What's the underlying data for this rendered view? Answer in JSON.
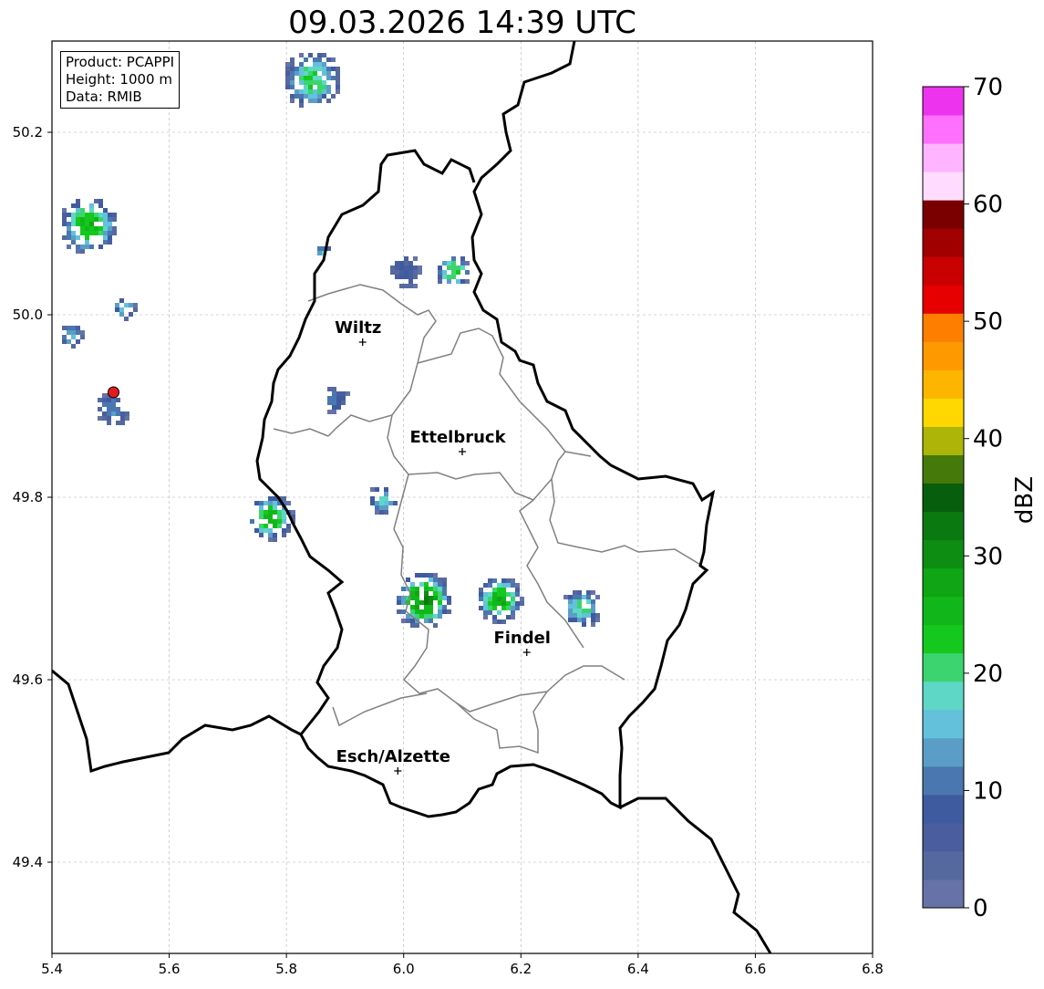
{
  "title": "09.03.2026 14:39 UTC",
  "info_box": {
    "product": "Product: PCAPPI",
    "height": "Height: 1000 m",
    "data": "Data: RMIB"
  },
  "axes": {
    "lon_range": [
      5.4,
      6.8
    ],
    "lat_range": [
      49.3,
      50.3
    ],
    "x_ticks": [
      "5.4",
      "5.6",
      "5.8",
      "6.0",
      "6.2",
      "6.4",
      "6.6",
      "6.8"
    ],
    "y_ticks": [
      "49.4",
      "49.6",
      "49.8",
      "50.0",
      "50.2"
    ],
    "grid": true
  },
  "cities": [
    {
      "name": "Wiltz",
      "lon": 5.93,
      "lat": 49.97
    },
    {
      "name": "Ettelbruck",
      "lon": 6.1,
      "lat": 49.85
    },
    {
      "name": "Findel",
      "lon": 6.21,
      "lat": 49.63
    },
    {
      "name": "Esch/Alzette",
      "lon": 5.99,
      "lat": 49.5
    }
  ],
  "radar_site": {
    "lon": 5.505,
    "lat": 49.915,
    "color": "#e41a1c"
  },
  "colorbar": {
    "label": "dBZ",
    "min": 0,
    "max": 70,
    "ticks": [
      "0",
      "10",
      "20",
      "30",
      "40",
      "50",
      "60",
      "70"
    ],
    "colors": [
      "#6673a8",
      "#56699f",
      "#4a5e9f",
      "#3f5ba0",
      "#4a77b0",
      "#5a9ec8",
      "#64c1dc",
      "#5fd7c6",
      "#3cd46e",
      "#14c81e",
      "#11b71a",
      "#10a515",
      "#0d8e12",
      "#0a7a10",
      "#075e0c",
      "#457a0a",
      "#adb508",
      "#fed800",
      "#feb500",
      "#fe9a00",
      "#fe7f00",
      "#e60000",
      "#c80000",
      "#a00000",
      "#7a0000",
      "#ffdcff",
      "#ffb4ff",
      "#ff70ff",
      "#ee33ee"
    ]
  },
  "echoes": [
    {
      "lon": 5.84,
      "lat": 50.26,
      "r": 0.05,
      "peak": 22
    },
    {
      "lon": 5.46,
      "lat": 50.1,
      "r": 0.05,
      "peak": 26
    },
    {
      "lon": 5.52,
      "lat": 50.01,
      "r": 0.02,
      "peak": 18
    },
    {
      "lon": 5.43,
      "lat": 49.98,
      "r": 0.02,
      "peak": 17
    },
    {
      "lon": 5.5,
      "lat": 49.9,
      "r": 0.03,
      "peak": 12
    },
    {
      "lon": 5.77,
      "lat": 49.78,
      "r": 0.04,
      "peak": 26
    },
    {
      "lon": 5.96,
      "lat": 49.8,
      "r": 0.025,
      "peak": 18
    },
    {
      "lon": 6.08,
      "lat": 50.05,
      "r": 0.03,
      "peak": 24
    },
    {
      "lon": 6.0,
      "lat": 50.05,
      "r": 0.03,
      "peak": 8
    },
    {
      "lon": 6.03,
      "lat": 49.69,
      "r": 0.05,
      "peak": 30
    },
    {
      "lon": 6.16,
      "lat": 49.69,
      "r": 0.04,
      "peak": 27
    },
    {
      "lon": 6.3,
      "lat": 49.68,
      "r": 0.035,
      "peak": 20
    },
    {
      "lon": 5.88,
      "lat": 49.91,
      "r": 0.025,
      "peak": 10
    },
    {
      "lon": 5.86,
      "lat": 50.07,
      "r": 0.015,
      "peak": 16
    }
  ]
}
